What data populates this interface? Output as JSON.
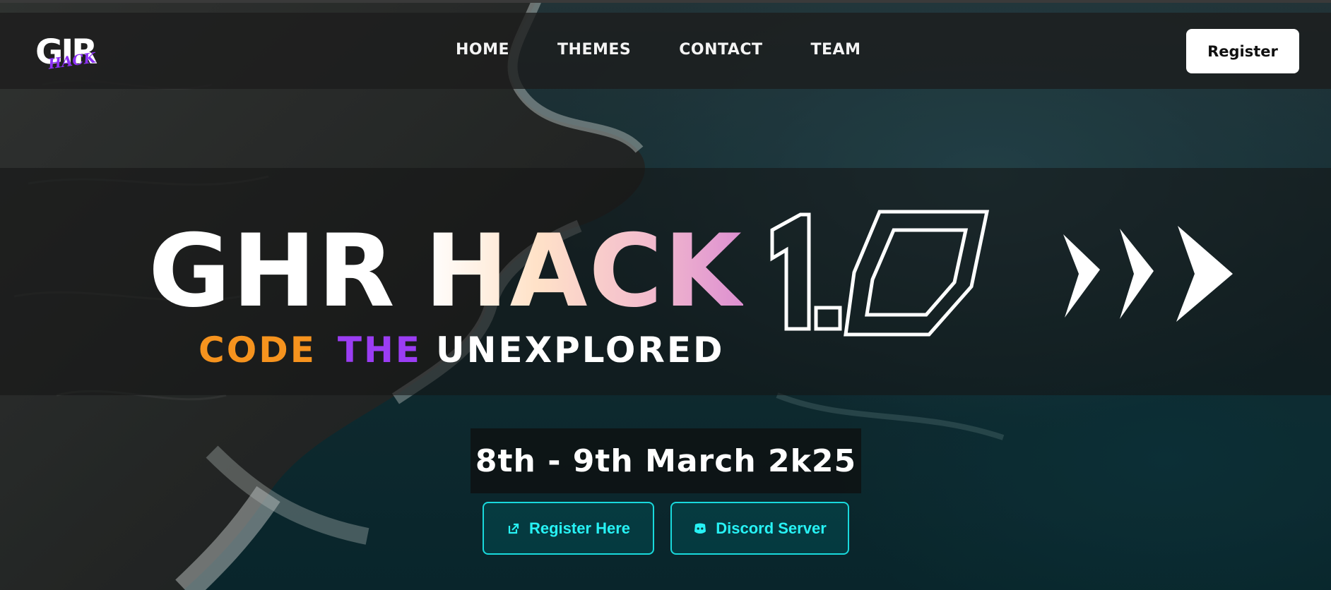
{
  "logo": {
    "main": "GIR",
    "sub": "HACK"
  },
  "nav": {
    "links": [
      {
        "label": "HOME"
      },
      {
        "label": "THEMES"
      },
      {
        "label": "CONTACT"
      },
      {
        "label": "TEAM"
      }
    ],
    "register_label": "Register"
  },
  "hero": {
    "title_part1": "GHR",
    "title_part2": "HACK",
    "version": "1.0",
    "tagline": {
      "part1": "CODE",
      "part2": "THE",
      "part3": "UNEXPLORED"
    },
    "tagline_colors": {
      "part1": "#f6931e",
      "part2": "#9b3df3",
      "part3": "#ffffff"
    }
  },
  "event": {
    "date": "8th - 9th March 2k25"
  },
  "cta": {
    "register": {
      "label": "Register Here",
      "icon": "external-link-icon"
    },
    "discord": {
      "label": "Discord Server",
      "icon": "discord-icon"
    }
  },
  "colors": {
    "accent": "#19d9dc",
    "accent_text": "#27f2f5",
    "nav_bg": "#1c1c1c",
    "brand_purple": "#8b2ff5"
  }
}
